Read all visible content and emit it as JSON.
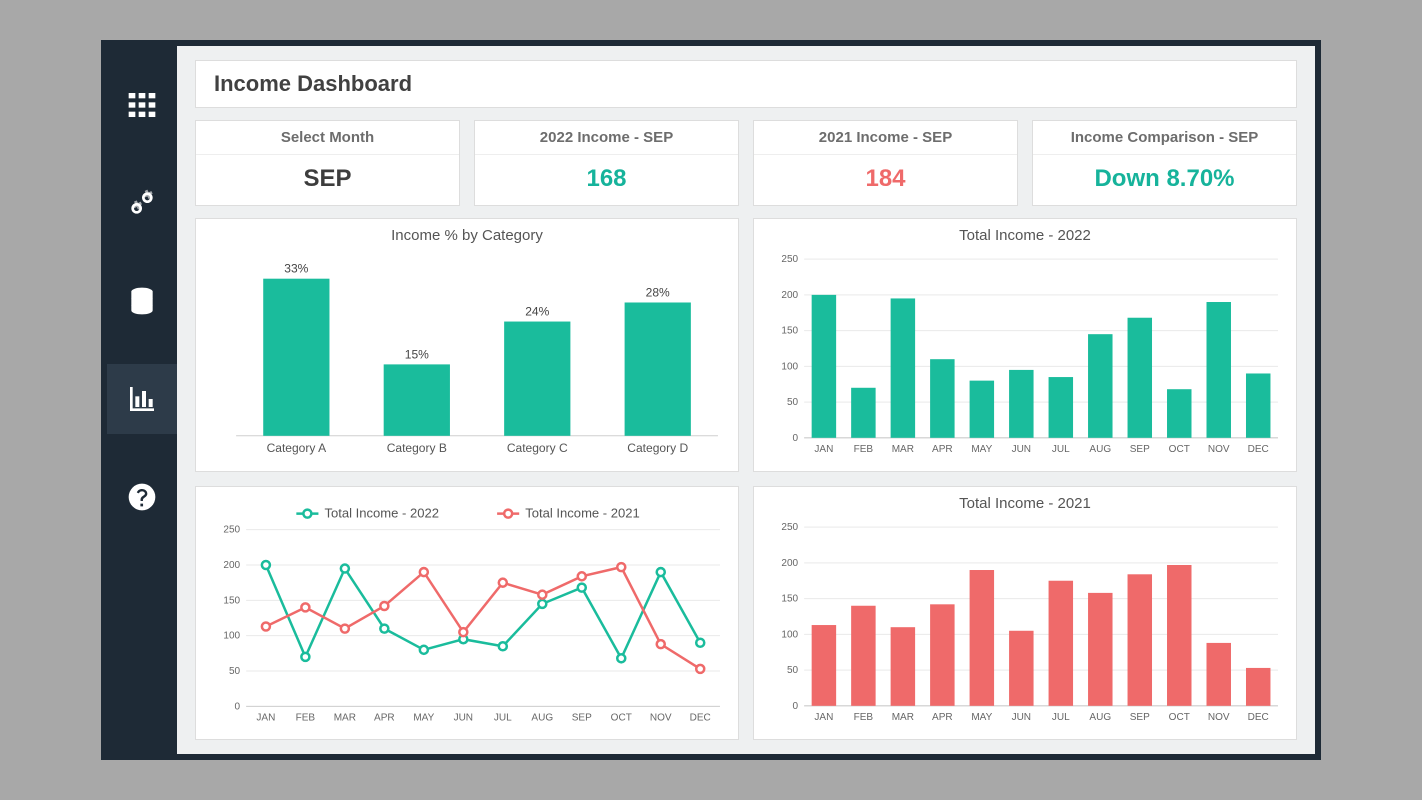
{
  "colors": {
    "teal": "#1abc9c",
    "red": "#ef6a6a",
    "dark": "#1e2a36"
  },
  "sidebar": {
    "items": [
      {
        "name": "grid-icon",
        "active": false
      },
      {
        "name": "gears-icon",
        "active": false
      },
      {
        "name": "database-icon",
        "active": false
      },
      {
        "name": "chart-icon",
        "active": true
      },
      {
        "name": "help-icon",
        "active": false
      }
    ]
  },
  "title": "Income Dashboard",
  "kpis": {
    "select_month": {
      "header": "Select Month",
      "value": "SEP"
    },
    "income_2022": {
      "header": "2022 Income - SEP",
      "value": "168"
    },
    "income_2021": {
      "header": "2021 Income - SEP",
      "value": "184"
    },
    "comparison": {
      "header": "Income Comparison - SEP",
      "value": "Down 8.70%"
    }
  },
  "chart_data": [
    {
      "id": "category_pct",
      "type": "bar",
      "title": "Income % by Category",
      "categories": [
        "Category A",
        "Category B",
        "Category C",
        "Category D"
      ],
      "values": [
        33,
        15,
        24,
        28
      ],
      "value_suffix": "%",
      "ylim": [
        0,
        35
      ],
      "color": "teal"
    },
    {
      "id": "total_2022",
      "type": "bar",
      "title": "Total Income - 2022",
      "categories": [
        "JAN",
        "FEB",
        "MAR",
        "APR",
        "MAY",
        "JUN",
        "JUL",
        "AUG",
        "SEP",
        "OCT",
        "NOV",
        "DEC"
      ],
      "values": [
        200,
        70,
        195,
        110,
        80,
        95,
        85,
        145,
        168,
        68,
        190,
        90
      ],
      "ylim": [
        0,
        250
      ],
      "yticks": [
        0,
        50,
        100,
        150,
        200,
        250
      ],
      "color": "teal"
    },
    {
      "id": "total_2021",
      "type": "bar",
      "title": "Total Income - 2021",
      "categories": [
        "JAN",
        "FEB",
        "MAR",
        "APR",
        "MAY",
        "JUN",
        "JUL",
        "AUG",
        "SEP",
        "OCT",
        "NOV",
        "DEC"
      ],
      "values": [
        113,
        140,
        110,
        142,
        190,
        105,
        175,
        158,
        184,
        197,
        88,
        53
      ],
      "ylim": [
        0,
        250
      ],
      "yticks": [
        0,
        50,
        100,
        150,
        200,
        250
      ],
      "color": "red"
    },
    {
      "id": "comparison_line",
      "type": "line",
      "title": "",
      "categories": [
        "JAN",
        "FEB",
        "MAR",
        "APR",
        "MAY",
        "JUN",
        "JUL",
        "AUG",
        "SEP",
        "OCT",
        "NOV",
        "DEC"
      ],
      "series": [
        {
          "name": "Total Income - 2022",
          "color": "teal",
          "values": [
            200,
            70,
            195,
            110,
            80,
            95,
            85,
            145,
            168,
            68,
            190,
            90
          ]
        },
        {
          "name": "Total Income - 2021",
          "color": "red",
          "values": [
            113,
            140,
            110,
            142,
            190,
            105,
            175,
            158,
            184,
            197,
            88,
            53
          ]
        }
      ],
      "ylim": [
        0,
        250
      ],
      "yticks": [
        0,
        50,
        100,
        150,
        200,
        250
      ],
      "legend_position": "top"
    }
  ]
}
